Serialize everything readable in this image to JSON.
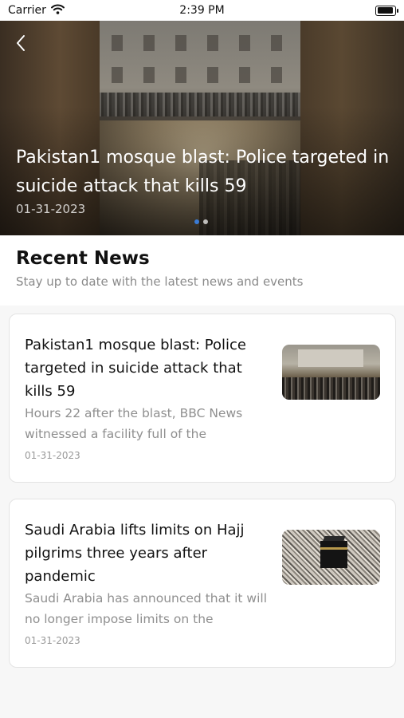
{
  "status_bar": {
    "carrier": "Carrier",
    "time": "2:39 PM"
  },
  "hero": {
    "title": "Pakistan1 mosque blast: Police targeted in suicide attack that kills 59",
    "date": "01-31-2023",
    "pager": {
      "count": 2,
      "active_index": 0
    }
  },
  "recent": {
    "title": "Recent News",
    "subtitle": "Stay up to date with the latest news and events"
  },
  "articles": [
    {
      "title": "Pakistan1 mosque blast: Police targeted in suicide attack that kills 59",
      "excerpt": "Hours 22 after the blast, BBC News witnessed a facility full of the",
      "date": "01-31-2023"
    },
    {
      "title": "Saudi Arabia lifts limits on Hajj pilgrims three years after pandemic",
      "excerpt": "Saudi Arabia has announced that it will no longer impose limits on the",
      "date": "01-31-2023"
    }
  ],
  "colors": {
    "pager_active": "#3a7bd5",
    "background": "#f7f7f7",
    "card_border": "#e3e3e3"
  }
}
